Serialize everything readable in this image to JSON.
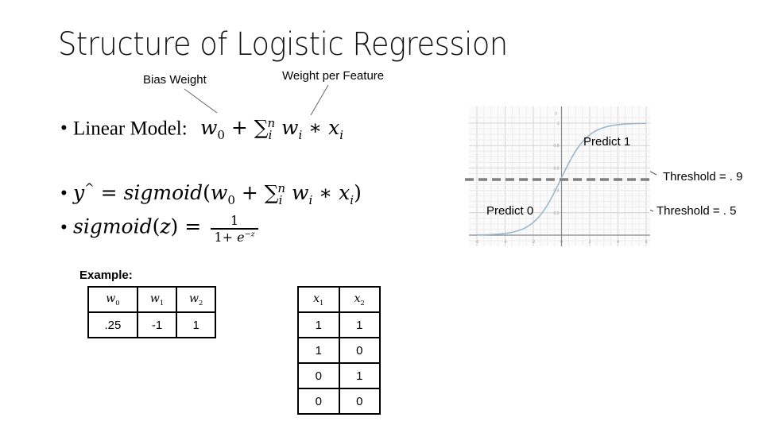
{
  "slide": {
    "title": "Structure of Logistic Regression",
    "annotations": {
      "bias_weight": "Bias Weight",
      "weight_per_feature": "Weight per Feature"
    },
    "bullets": [
      {
        "prefix": "Linear Model:",
        "formula": "w0 + Σ_i^n w_i * x_i"
      },
      {
        "formula": "y^ = sigmoid(w0 + Σ_i^n w_i * x_i)"
      },
      {
        "formula": "sigmoid(z) = 1 / (1 + e^-z)",
        "numerator": "1",
        "denominator": "1+ e^-z"
      }
    ],
    "graph": {
      "labels": {
        "predict_1": "Predict 1",
        "predict_0": "Predict 0",
        "threshold_high": "Threshold = . 9",
        "threshold_mid": "Threshold = . 5"
      }
    },
    "example": {
      "label": "Example:",
      "weights_table": {
        "headers": [
          "w0",
          "w1",
          "w2"
        ],
        "rows": [
          [
            ".25",
            "-1",
            "1"
          ]
        ]
      },
      "inputs_table": {
        "headers": [
          "x1",
          "x2"
        ],
        "rows": [
          [
            "1",
            "1"
          ],
          [
            "1",
            "0"
          ],
          [
            "0",
            "1"
          ],
          [
            "0",
            "0"
          ]
        ]
      }
    }
  },
  "chart_data": {
    "type": "line",
    "title": "",
    "xlabel": "",
    "ylabel": "y",
    "xlim": [
      -6,
      6
    ],
    "ylim": [
      0,
      1
    ],
    "x_ticks": [
      "-6",
      "-4",
      "-2",
      "0",
      "2",
      "4",
      "6"
    ],
    "y_ticks": [
      "0.2",
      "0.4",
      "0.6",
      "0.8",
      "1"
    ],
    "grid": true,
    "series": [
      {
        "name": "sigmoid",
        "function": "1/(1+e^-x)",
        "color": "#9ab8cc"
      }
    ],
    "threshold_line": {
      "y": 0.5,
      "style": "dashed",
      "color": "#808080"
    }
  }
}
